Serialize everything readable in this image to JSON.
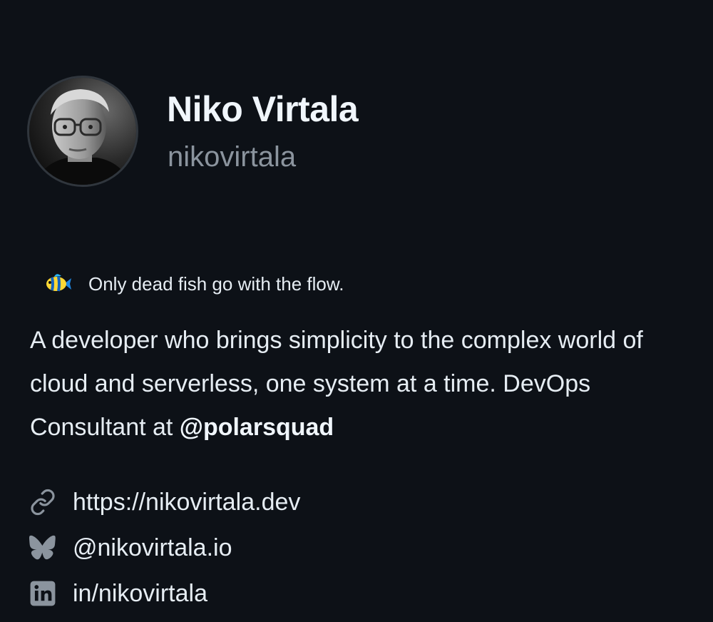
{
  "profile": {
    "name": "Niko Virtala",
    "username": "nikovirtala"
  },
  "status": {
    "emoji": "tropical-fish",
    "text": "Only dead fish go with the flow."
  },
  "bio": {
    "text_before": "A developer who brings simplicity to the complex world of cloud and serverless, one system at a time. DevOps Consultant at ",
    "mention": "@polarsquad"
  },
  "links": [
    {
      "icon": "link-icon",
      "text": "https://nikovirtala.dev"
    },
    {
      "icon": "bluesky-icon",
      "text": "@nikovirtala.io"
    },
    {
      "icon": "linkedin-icon",
      "text": "in/nikovirtala"
    }
  ],
  "colors": {
    "background": "#0d1117",
    "text": "#e6edf3",
    "muted": "#8b949e",
    "icon": "#8b949e"
  }
}
